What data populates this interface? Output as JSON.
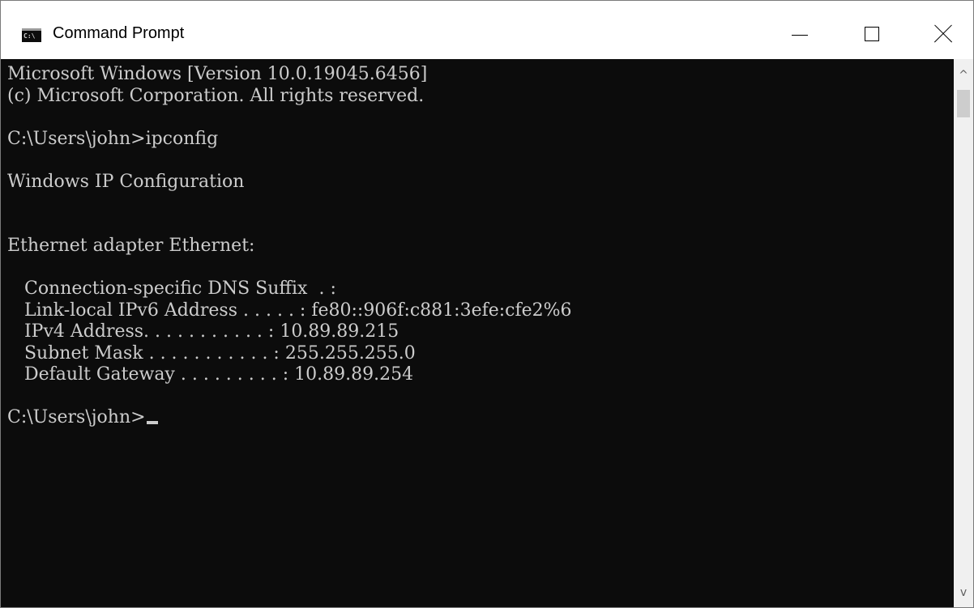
{
  "window": {
    "title": "Command Prompt",
    "icon_label": "C:\\",
    "controls": {
      "minimize": "minimize-icon",
      "maximize": "maximize-icon",
      "close": "close-icon"
    }
  },
  "console": {
    "lines": [
      "Microsoft Windows [Version 10.0.19045.6456]",
      "(c) Microsoft Corporation. All rights reserved.",
      "",
      "C:\\Users\\john>ipconfig",
      "",
      "Windows IP Configuration",
      "",
      "",
      "Ethernet adapter Ethernet:",
      "",
      "   Connection-specific DNS Suffix  . :",
      "   Link-local IPv6 Address . . . . . : fe80::906f:c881:3efe:cfe2%6",
      "   IPv4 Address. . . . . . . . . . . : 10.89.89.215",
      "   Subnet Mask . . . . . . . . . . . : 255.255.255.0",
      "   Default Gateway . . . . . . . . . : 10.89.89.254",
      "",
      "C:\\Users\\john>"
    ]
  },
  "scrollbar": {
    "up_arrow": "^",
    "down_arrow": "v"
  },
  "colors": {
    "console_background": "#0c0c0c",
    "console_text": "#cccccc",
    "titlebar_background": "#ffffff"
  }
}
